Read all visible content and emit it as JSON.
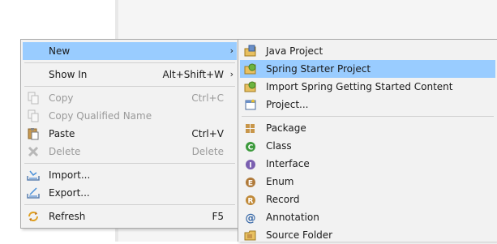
{
  "context_menu": {
    "items": [
      {
        "label": "New",
        "shortcut": "",
        "arrow": "›",
        "icon": "none"
      },
      {
        "label": "Show In",
        "shortcut": "Alt+Shift+W",
        "arrow": "›",
        "icon": "none"
      },
      {
        "label": "Copy",
        "shortcut": "Ctrl+C",
        "icon": "copy-icon"
      },
      {
        "label": "Copy Qualified Name",
        "shortcut": "",
        "icon": "copy-qualified-icon"
      },
      {
        "label": "Paste",
        "shortcut": "Ctrl+V",
        "icon": "paste-icon"
      },
      {
        "label": "Delete",
        "shortcut": "Delete",
        "icon": "delete-icon"
      },
      {
        "label": "Import...",
        "shortcut": "",
        "icon": "import-icon"
      },
      {
        "label": "Export...",
        "shortcut": "",
        "icon": "export-icon"
      },
      {
        "label": "Refresh",
        "shortcut": "F5",
        "icon": "refresh-icon"
      }
    ]
  },
  "submenu": {
    "items": [
      {
        "label": "Java Project",
        "icon": "java-project-icon"
      },
      {
        "label": "Spring Starter Project",
        "icon": "spring-starter-icon"
      },
      {
        "label": "Import Spring Getting Started Content",
        "icon": "spring-import-icon"
      },
      {
        "label": "Project...",
        "icon": "project-icon"
      },
      {
        "label": "Package",
        "icon": "package-icon"
      },
      {
        "label": "Class",
        "icon": "class-icon"
      },
      {
        "label": "Interface",
        "icon": "interface-icon"
      },
      {
        "label": "Enum",
        "icon": "enum-icon"
      },
      {
        "label": "Record",
        "icon": "record-icon"
      },
      {
        "label": "Annotation",
        "icon": "annotation-icon"
      },
      {
        "label": "Source Folder",
        "icon": "source-folder-icon"
      }
    ]
  },
  "colors": {
    "selection": "#99ccff",
    "menu_bg": "#f2f2f2",
    "disabled_text": "#9a9a9a"
  }
}
